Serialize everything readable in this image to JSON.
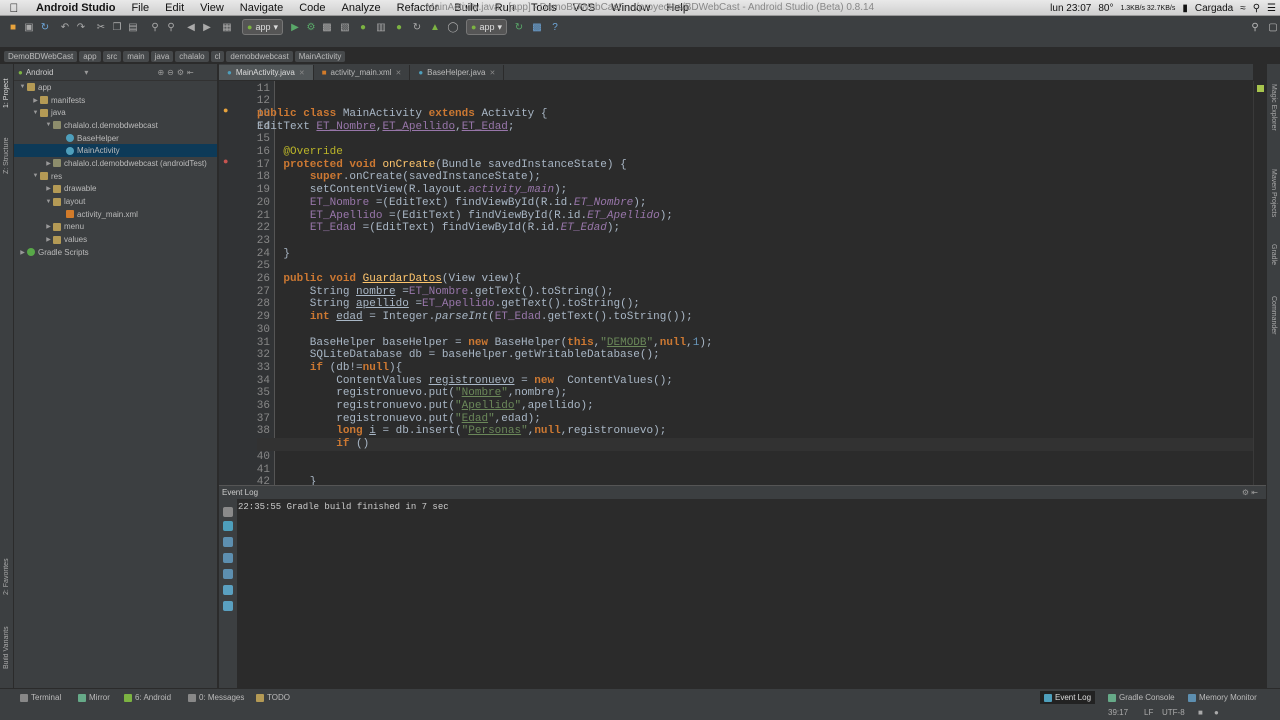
{
  "menubar": {
    "app_name": "Android Studio",
    "items": [
      "File",
      "Edit",
      "View",
      "Navigate",
      "Code",
      "Analyze",
      "Refactor",
      "Build",
      "Run",
      "Tools",
      "VCS",
      "Window",
      "Help"
    ],
    "window_title": "MainActivity.java - [app] - DemoBDWebCast - ~/proyectos/BDWebCast - Android Studio (Beta) 0.8.14",
    "status": {
      "clock": "lun 23:07",
      "temperature": "80°",
      "network_rate": "1.3KB/s 32.7KB/s",
      "battery": "Cargada"
    }
  },
  "toolbar": {
    "config": "app",
    "config2": "app"
  },
  "breadcrumbs": [
    "DemoBDWebCast",
    "app",
    "src",
    "main",
    "java",
    "chalalo",
    "cl",
    "demobdwebcast",
    "MainActivity"
  ],
  "left_strip": {
    "project": "1: Project",
    "structure": "Z: Structure",
    "favorites": "2: Favorites",
    "build_variants": "Build Variants"
  },
  "right_strip": {
    "maven": "Maven Projects",
    "gradle": "Gradle",
    "commander": "Commander",
    "magic": "Magic Explorer"
  },
  "project_panel": {
    "view_mode": "Android",
    "tree": [
      {
        "label": "app",
        "depth": 0,
        "kind": "folder",
        "expanded": true
      },
      {
        "label": "manifests",
        "depth": 1,
        "kind": "folder",
        "expanded": false
      },
      {
        "label": "java",
        "depth": 1,
        "kind": "folder",
        "expanded": true
      },
      {
        "label": "chalalo.cl.demobdwebcast",
        "depth": 2,
        "kind": "pkg",
        "expanded": true
      },
      {
        "label": "BaseHelper",
        "depth": 3,
        "kind": "cls",
        "expanded": null
      },
      {
        "label": "MainActivity",
        "depth": 3,
        "kind": "cls",
        "expanded": null,
        "selected": true
      },
      {
        "label": "chalalo.cl.demobdwebcast (androidTest)",
        "depth": 2,
        "kind": "pkg",
        "expanded": false
      },
      {
        "label": "res",
        "depth": 1,
        "kind": "folder",
        "expanded": true
      },
      {
        "label": "drawable",
        "depth": 2,
        "kind": "folder",
        "expanded": false
      },
      {
        "label": "layout",
        "depth": 2,
        "kind": "folder",
        "expanded": true
      },
      {
        "label": "activity_main.xml",
        "depth": 3,
        "kind": "xml",
        "expanded": null
      },
      {
        "label": "menu",
        "depth": 2,
        "kind": "folder",
        "expanded": false
      },
      {
        "label": "values",
        "depth": 2,
        "kind": "folder",
        "expanded": false
      },
      {
        "label": "Gradle Scripts",
        "depth": 0,
        "kind": "grad",
        "expanded": false
      }
    ]
  },
  "editor_tabs": [
    {
      "label": "MainActivity.java",
      "active": true
    },
    {
      "label": "activity_main.xml",
      "active": false
    },
    {
      "label": "BaseHelper.java",
      "active": false
    }
  ],
  "editor": {
    "current_line": 39,
    "lines": [
      {
        "n": 11,
        "html": ""
      },
      {
        "n": 12,
        "html": ""
      },
      {
        "n": 13,
        "html": "<span class=\"kw\">public class</span> MainActivity <span class=\"kw\">extends</span> Activity {"
      },
      {
        "n": 14,
        "html": "EditText <span class=\"fld un\">ET_Nombre</span>,<span class=\"fld un\">ET_Apellido</span>,<span class=\"fld un\">ET_Edad</span>;"
      },
      {
        "n": 15,
        "html": ""
      },
      {
        "n": 16,
        "html": "    <span class=\"ann\">@Override</span>"
      },
      {
        "n": 17,
        "html": "    <span class=\"kw\">protected void</span> <span class=\"fn\">onCreate</span>(Bundle savedInstanceState) {"
      },
      {
        "n": 18,
        "html": "        <span class=\"kw\">super</span>.onCreate(savedInstanceState);"
      },
      {
        "n": 19,
        "html": "        setContentView(R.layout.<span class=\"fldi\">activity_main</span>);"
      },
      {
        "n": 20,
        "html": "        <span class=\"fld\">ET_Nombre</span> =(EditText) findViewById(R.id.<span class=\"fldi\">ET_Nombre</span>);"
      },
      {
        "n": 21,
        "html": "        <span class=\"fld\">ET_Apellido</span> =(EditText) findViewById(R.id.<span class=\"fldi\">ET_Apellido</span>);"
      },
      {
        "n": 22,
        "html": "        <span class=\"fld\">ET_Edad</span> =(EditText) findViewById(R.id.<span class=\"fldi\">ET_Edad</span>);"
      },
      {
        "n": 23,
        "html": ""
      },
      {
        "n": 24,
        "html": "    }"
      },
      {
        "n": 25,
        "html": ""
      },
      {
        "n": 26,
        "html": "    <span class=\"kw\">public void</span> <span class=\"fn un\">GuardarDatos</span>(View view){"
      },
      {
        "n": 27,
        "html": "        String <span class=\"un\">nombre</span> =<span class=\"fld\">ET_Nombre</span>.getText().toString();"
      },
      {
        "n": 28,
        "html": "        String <span class=\"un\">apellido</span> =<span class=\"fld\">ET_Apellido</span>.getText().toString();"
      },
      {
        "n": 29,
        "html": "        <span class=\"kw\">int</span> <span class=\"un\">edad</span> = Integer.<span class=\"it\">parseInt</span>(<span class=\"fld\">ET_Edad</span>.getText().toString());"
      },
      {
        "n": 30,
        "html": ""
      },
      {
        "n": 31,
        "html": "        BaseHelper baseHelper = <span class=\"kw\">new</span> BaseHelper(<span class=\"kw\">this</span>,<span class=\"str\">\"<span class=\"un\">DEMODB</span>\"</span>,<span class=\"kw\">null</span>,<span class=\"num\">1</span>);"
      },
      {
        "n": 32,
        "html": "        SQLiteDatabase db = baseHelper.getWritableDatabase();"
      },
      {
        "n": 33,
        "html": "        <span class=\"kw\">if</span> (db!=<span class=\"kw\">null</span>){"
      },
      {
        "n": 34,
        "html": "            ContentValues <span class=\"un\">registronuevo</span> = <span class=\"kw\">new</span>  ContentValues();"
      },
      {
        "n": 35,
        "html": "            registronuevo.put(<span class=\"str\">\"<span class=\"un\">Nombre</span>\"</span>,nombre);"
      },
      {
        "n": 36,
        "html": "            registronuevo.put(<span class=\"str\">\"<span class=\"un\">Apellido</span>\"</span>,apellido);"
      },
      {
        "n": 37,
        "html": "            registronuevo.put(<span class=\"str\">\"<span class=\"un\">Edad</span>\"</span>,edad);"
      },
      {
        "n": 38,
        "html": "            <span class=\"kw\">long</span> <span class=\"un\">i</span> = db.insert(<span class=\"str\">\"<span class=\"un\">Personas</span>\"</span>,<span class=\"kw\">null</span>,registronuevo);"
      },
      {
        "n": 39,
        "html": "            <span class=\"kw\">if</span> ()"
      },
      {
        "n": 40,
        "html": ""
      },
      {
        "n": 41,
        "html": ""
      },
      {
        "n": 42,
        "html": "        }"
      }
    ]
  },
  "event_log": {
    "title": "Event Log",
    "message": "22:35:55 Gradle build finished in 7 sec"
  },
  "statusbar": {
    "tabs": [
      "Terminal",
      "Mirror",
      "6: Android",
      "0: Messages",
      "TODO"
    ],
    "right_tabs": [
      "Event Log",
      "Gradle Console",
      "Memory Monitor"
    ],
    "position": "39:17",
    "line_sep": "LF",
    "encoding": "UTF-8"
  }
}
